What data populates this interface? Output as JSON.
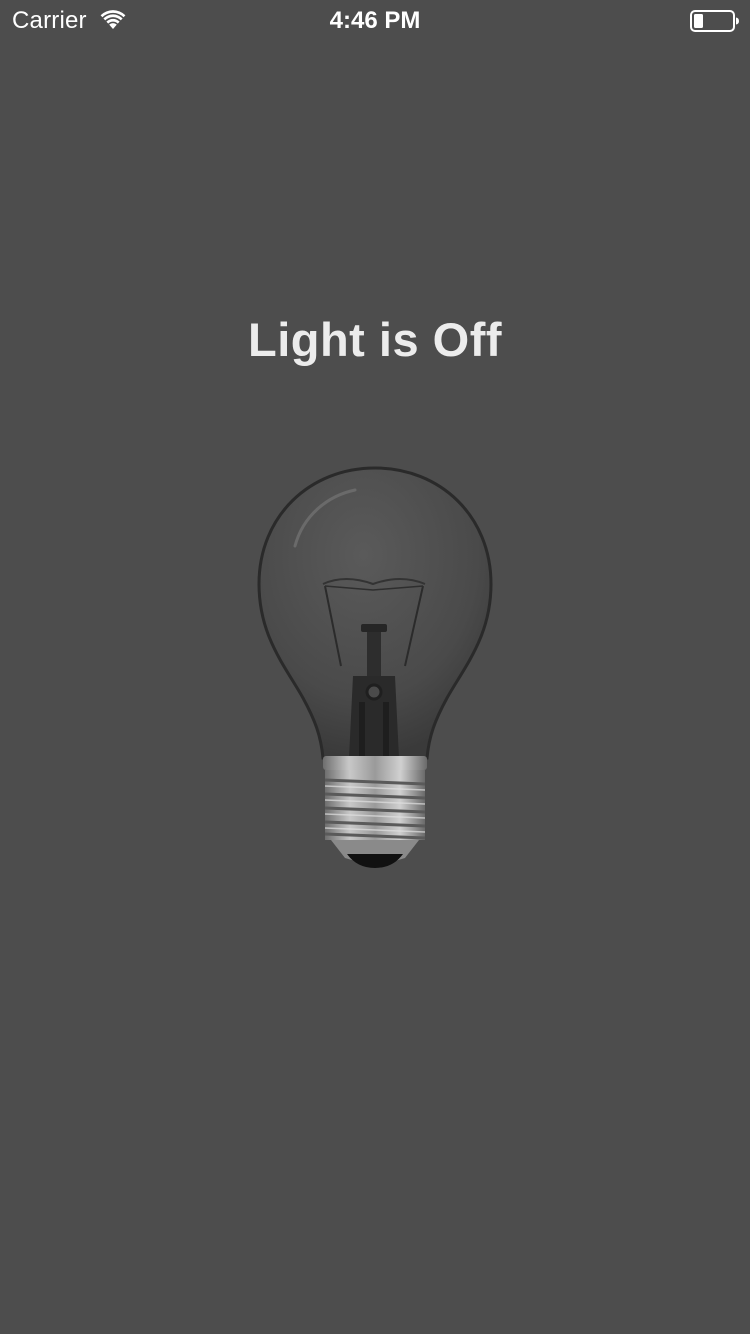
{
  "status_bar": {
    "carrier": "Carrier",
    "time": "4:46 PM",
    "wifi_icon": "wifi-icon",
    "battery_icon": "battery-icon",
    "battery_level": 0.25
  },
  "main": {
    "title": "Light is Off",
    "bulb_icon": "lightbulb-icon",
    "state": "off"
  },
  "colors": {
    "background": "#4d4d4d",
    "title": "#ececec",
    "status_text": "#ffffff"
  }
}
